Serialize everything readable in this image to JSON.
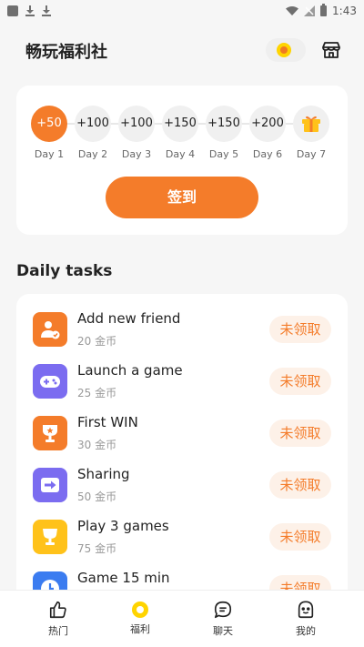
{
  "status_bar": {
    "time": "1:43"
  },
  "header": {
    "title": "畅玩福利社"
  },
  "checkin": {
    "days": [
      {
        "reward": "+50",
        "label": "Day 1",
        "active": true
      },
      {
        "reward": "+100",
        "label": "Day 2"
      },
      {
        "reward": "+100",
        "label": "Day 3"
      },
      {
        "reward": "+150",
        "label": "Day 4"
      },
      {
        "reward": "+150",
        "label": "Day 5"
      },
      {
        "reward": "+200",
        "label": "Day 6"
      },
      {
        "reward": "",
        "label": "Day 7",
        "icon": "gift-icon"
      }
    ],
    "sign_label": "签到"
  },
  "tasks": {
    "title": "Daily tasks",
    "items": [
      {
        "name": "Add new friend",
        "reward": "20 金币",
        "button": "未领取",
        "icon": "add-friend-icon",
        "color": "#f47c2a"
      },
      {
        "name": "Launch a game",
        "reward": "25 金币",
        "button": "未领取",
        "icon": "gamepad-icon",
        "color": "#7b6cf0"
      },
      {
        "name": "First WIN",
        "reward": "30 金币",
        "button": "未领取",
        "icon": "trophy-icon",
        "color": "#f47c2a"
      },
      {
        "name": "Sharing",
        "reward": "50 金币",
        "button": "未领取",
        "icon": "share-icon",
        "color": "#7b6cf0"
      },
      {
        "name": "Play 3 games",
        "reward": "75 金币",
        "button": "未领取",
        "icon": "cup-icon",
        "color": "#ffc21a"
      },
      {
        "name": "Game 15 min",
        "reward": "",
        "button": "未领取",
        "icon": "clock-icon",
        "color": "#3b7cf0"
      }
    ]
  },
  "nav": {
    "items": [
      {
        "label": "热门",
        "icon": "thumbs-up-icon"
      },
      {
        "label": "福利",
        "icon": "coin-icon",
        "active": true
      },
      {
        "label": "聊天",
        "icon": "chat-icon"
      },
      {
        "label": "我的",
        "icon": "profile-icon"
      }
    ]
  },
  "colors": {
    "accent": "#f47c2a",
    "yellow": "#ffd400"
  }
}
